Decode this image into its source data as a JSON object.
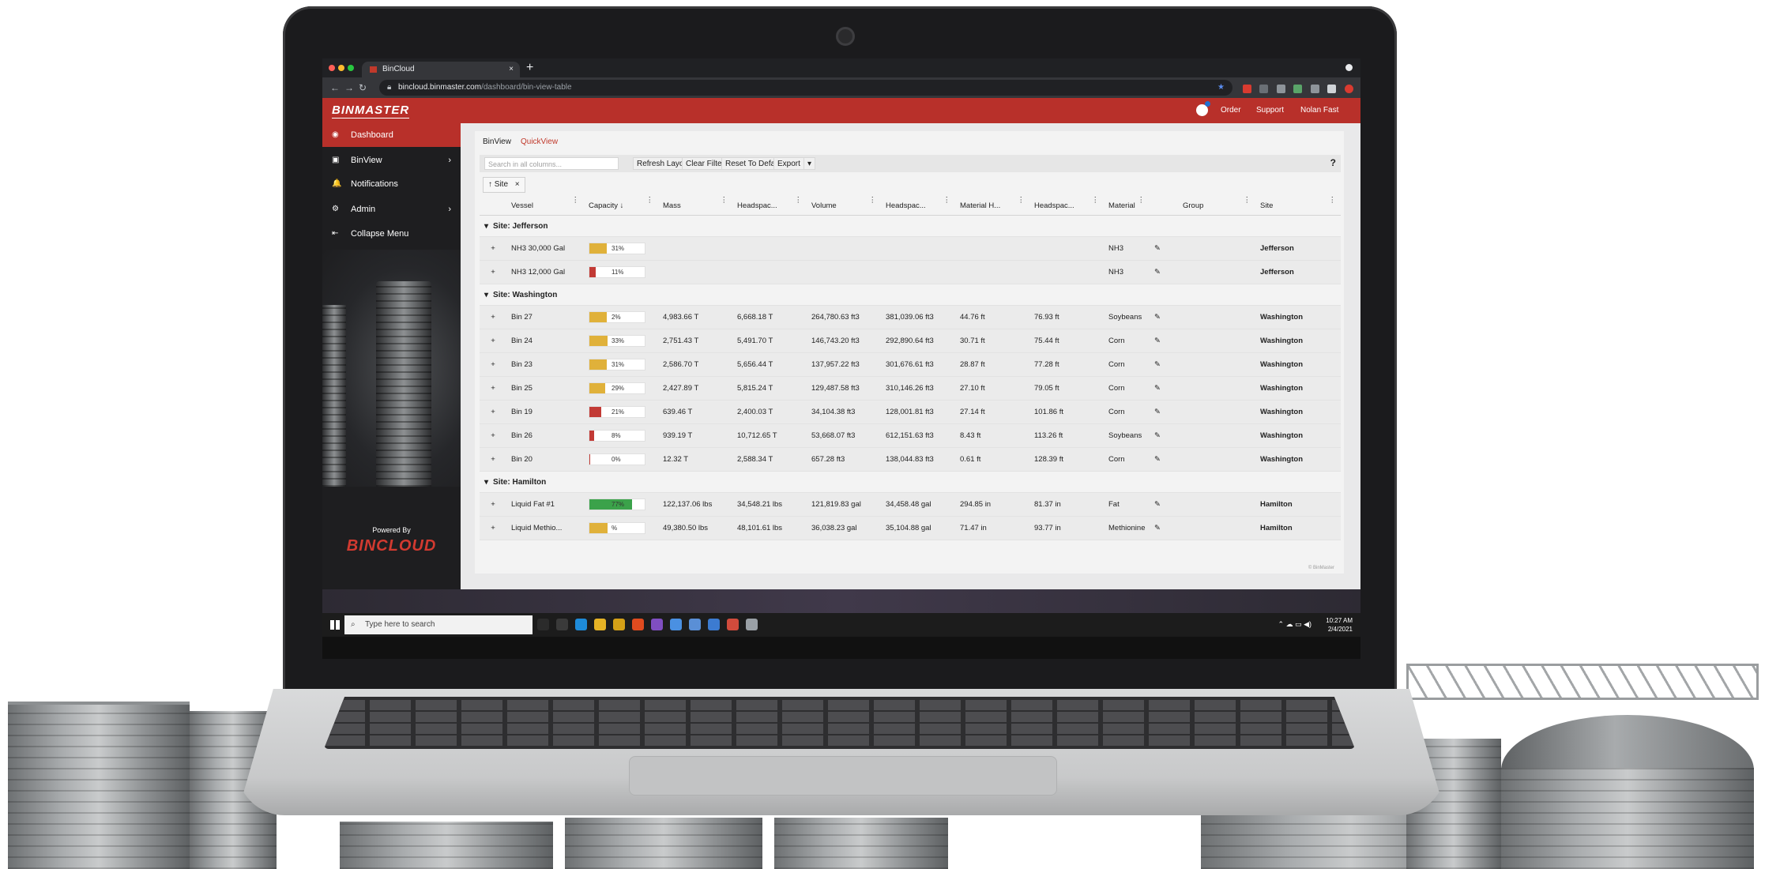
{
  "browser": {
    "tab_title": "BinCloud",
    "tab_close": "×",
    "new_tab": "+",
    "url_host": "bincloud.binmaster.com",
    "url_path": "/dashboard/bin-view-table"
  },
  "header": {
    "logo": "BINMASTER",
    "links": [
      "Order",
      "Support",
      "Nolan Fast"
    ],
    "accent_color": "#b8302a"
  },
  "sidebar": {
    "items": [
      {
        "label": "Dashboard",
        "icon": "gauge-icon",
        "glyph": "◉",
        "active": true
      },
      {
        "label": "BinView",
        "icon": "bin-icon",
        "glyph": "▣",
        "chevron": "›"
      },
      {
        "label": "Notifications",
        "icon": "bell-icon",
        "glyph": "🔔"
      },
      {
        "label": "Admin",
        "icon": "gears-icon",
        "glyph": "⚙",
        "chevron": "›"
      },
      {
        "label": "Collapse Menu",
        "icon": "collapse-icon",
        "glyph": "⇤"
      }
    ],
    "powered_by": "Powered By",
    "brand": "BINCLOUD"
  },
  "views": {
    "tabs": [
      "BinView",
      "QuickView"
    ]
  },
  "toolbar": {
    "search_placeholder": "Search in all columns...",
    "refresh": "Refresh Layout",
    "clear": "Clear Filter",
    "reset": "Reset To Default",
    "export": "Export",
    "export_caret": "▾",
    "help": "?"
  },
  "group_chip": {
    "label": "↑ Site",
    "remove": "×"
  },
  "grid": {
    "columns": [
      "",
      "Vessel",
      "Capacity ↓",
      "Mass",
      "Headspac...",
      "Volume",
      "Headspac...",
      "Material H...",
      "Headspac...",
      "Material",
      "",
      "Group",
      "Site"
    ],
    "groups": [
      {
        "title": "Site: Jefferson",
        "rows": [
          {
            "vessel": "NH3 30,000 Gal",
            "capacity": 31,
            "cap_label": "31%",
            "cap_color": "#e0b13a",
            "mass": "",
            "headspace_mass": "",
            "volume": "",
            "headspace_volume": "",
            "material_height": "",
            "headspace_height": "",
            "material": "NH3",
            "group": "",
            "site": "Jefferson"
          },
          {
            "vessel": "NH3 12,000 Gal",
            "capacity": 11,
            "cap_label": "11%",
            "cap_color": "#c23a35",
            "mass": "",
            "headspace_mass": "",
            "volume": "",
            "headspace_volume": "",
            "material_height": "",
            "headspace_height": "",
            "material": "NH3",
            "group": "",
            "site": "Jefferson"
          }
        ]
      },
      {
        "title": "Site: Washington",
        "rows": [
          {
            "vessel": "Bin 27",
            "capacity": 32,
            "cap_label": "2%",
            "cap_color": "#e0b13a",
            "mass": "4,983.66 T",
            "headspace_mass": "6,668.18 T",
            "volume": "264,780.63 ft3",
            "headspace_volume": "381,039.06 ft3",
            "material_height": "44.76 ft",
            "headspace_height": "76.93 ft",
            "material": "Soybeans",
            "group": "",
            "site": "Washington"
          },
          {
            "vessel": "Bin 24",
            "capacity": 33,
            "cap_label": "33%",
            "cap_color": "#e0b13a",
            "mass": "2,751.43 T",
            "headspace_mass": "5,491.70 T",
            "volume": "146,743.20 ft3",
            "headspace_volume": "292,890.64 ft3",
            "material_height": "30.71 ft",
            "headspace_height": "75.44 ft",
            "material": "Corn",
            "group": "",
            "site": "Washington"
          },
          {
            "vessel": "Bin 23",
            "capacity": 31,
            "cap_label": "31%",
            "cap_color": "#e0b13a",
            "mass": "2,586.70 T",
            "headspace_mass": "5,656.44 T",
            "volume": "137,957.22 ft3",
            "headspace_volume": "301,676.61 ft3",
            "material_height": "28.87 ft",
            "headspace_height": "77.28 ft",
            "material": "Corn",
            "group": "",
            "site": "Washington"
          },
          {
            "vessel": "Bin 25",
            "capacity": 29,
            "cap_label": "29%",
            "cap_color": "#e0b13a",
            "mass": "2,427.89 T",
            "headspace_mass": "5,815.24 T",
            "volume": "129,487.58 ft3",
            "headspace_volume": "310,146.26 ft3",
            "material_height": "27.10 ft",
            "headspace_height": "79.05 ft",
            "material": "Corn",
            "group": "",
            "site": "Washington"
          },
          {
            "vessel": "Bin 19",
            "capacity": 21,
            "cap_label": "21%",
            "cap_color": "#c23a35",
            "mass": "639.46 T",
            "headspace_mass": "2,400.03 T",
            "volume": "34,104.38 ft3",
            "headspace_volume": "128,001.81 ft3",
            "material_height": "27.14 ft",
            "headspace_height": "101.86 ft",
            "material": "Corn",
            "group": "",
            "site": "Washington"
          },
          {
            "vessel": "Bin 26",
            "capacity": 8,
            "cap_label": "8%",
            "cap_color": "#c23a35",
            "mass": "939.19 T",
            "headspace_mass": "10,712.65 T",
            "volume": "53,668.07 ft3",
            "headspace_volume": "612,151.63 ft3",
            "material_height": "8.43 ft",
            "headspace_height": "113.26 ft",
            "material": "Soybeans",
            "group": "",
            "site": "Washington"
          },
          {
            "vessel": "Bin 20",
            "capacity": 0,
            "cap_label": "0%",
            "cap_color": "#c23a35",
            "mass": "12.32 T",
            "headspace_mass": "2,588.34 T",
            "volume": "657.28 ft3",
            "headspace_volume": "138,044.83 ft3",
            "material_height": "0.61 ft",
            "headspace_height": "128.39 ft",
            "material": "Corn",
            "group": "",
            "site": "Washington"
          }
        ]
      },
      {
        "title": "Site: Hamilton",
        "rows": [
          {
            "vessel": "Liquid Fat #1",
            "capacity": 77,
            "cap_label": "77%",
            "cap_color": "#3ba24a",
            "mass": "122,137.06 lbs",
            "headspace_mass": "34,548.21 lbs",
            "volume": "121,819.83 gal",
            "headspace_volume": "34,458.48 gal",
            "material_height": "294.85 in",
            "headspace_height": "81.37 in",
            "material": "Fat",
            "group": "",
            "site": "Hamilton"
          },
          {
            "vessel": "Liquid Methio...",
            "capacity": 33,
            "cap_label": "%",
            "cap_color": "#e0b13a",
            "mass": "49,380.50 lbs",
            "headspace_mass": "48,101.61 lbs",
            "volume": "36,038.23 gal",
            "headspace_volume": "35,104.88 gal",
            "material_height": "71.47 in",
            "headspace_height": "93.77 in",
            "material": "Methionine",
            "group": "",
            "site": "Hamilton"
          }
        ]
      }
    ],
    "row_expand": "+",
    "edit_glyph": "✎",
    "group_caret": "▾",
    "col_menu": "⋮"
  },
  "taskbar": {
    "search_placeholder": "Type here to search",
    "time": "10:27 AM",
    "date": "2/4/2021",
    "app_icons": [
      "#2b2b2b",
      "#3a3a3a",
      "#1e8bd9",
      "#e6b325",
      "#d4a017",
      "#e04b1f",
      "#7f4ec1",
      "#4a90e2",
      "#5a8fd6",
      "#3c7bd1",
      "#d14b3c",
      "#9aa0a6"
    ]
  }
}
